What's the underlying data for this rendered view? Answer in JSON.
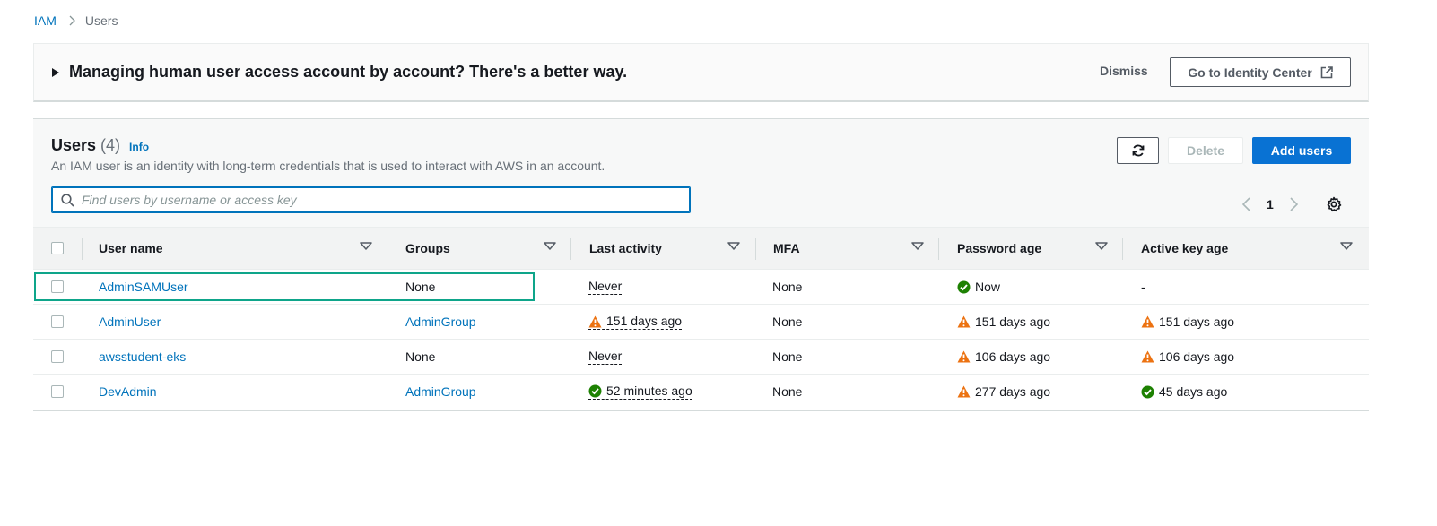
{
  "breadcrumb": {
    "root": "IAM",
    "current": "Users"
  },
  "banner": {
    "title": "Managing human user access account by account? There's a better way.",
    "dismiss_label": "Dismiss",
    "goto_label": "Go to Identity Center"
  },
  "users_panel": {
    "title": "Users",
    "count": "(4)",
    "info_label": "Info",
    "description": "An IAM user is an identity with long-term credentials that is used to interact with AWS in an account.",
    "delete_label": "Delete",
    "add_label": "Add users",
    "search_placeholder": "Find users by username or access key",
    "search_value": "",
    "page_number": "1"
  },
  "table": {
    "columns": [
      "User name",
      "Groups",
      "Last activity",
      "MFA",
      "Password age",
      "Active key age"
    ],
    "rows": [
      {
        "user_name": "AdminSAMUser",
        "groups": "None",
        "last_activity": "Never",
        "mfa": "None",
        "password_age": "Now",
        "active_key_age": "-"
      },
      {
        "user_name": "AdminUser",
        "groups": "AdminGroup",
        "last_activity": "151 days ago",
        "mfa": "None",
        "password_age": "151 days ago",
        "active_key_age": "151 days ago"
      },
      {
        "user_name": "awsstudent-eks",
        "groups": "None",
        "last_activity": "Never",
        "mfa": "None",
        "password_age": "106 days ago",
        "active_key_age": "106 days ago"
      },
      {
        "user_name": "DevAdmin",
        "groups": "AdminGroup",
        "last_activity": "52 minutes ago",
        "mfa": "None",
        "password_age": "277 days ago",
        "active_key_age": "45 days ago"
      }
    ]
  },
  "colors": {
    "link": "#0073bb",
    "primary_button": "#0972d3",
    "warning": "#ec7211",
    "success": "#1d8102",
    "highlight": "#0ea58a"
  }
}
